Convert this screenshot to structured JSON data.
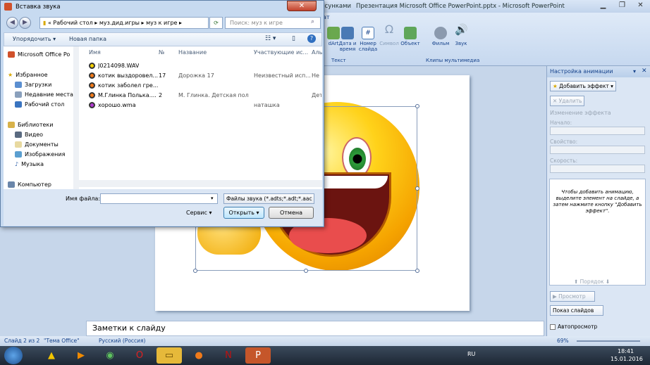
{
  "powerpoint": {
    "title": "Презентация Microsoft Office PowerPoint.pptx - Microsoft PowerPoint",
    "ribbon_tab_partial": "исунками",
    "ribbon_tab_partial2": "ат",
    "ribbon_buttons": [
      {
        "label": "dArt",
        "icon": "smartart-icon"
      },
      {
        "label": "Дата и время",
        "icon": "calendar-icon"
      },
      {
        "label": "Номер слайда",
        "icon": "slide-number-icon"
      },
      {
        "label": "Символ",
        "icon": "omega-icon"
      },
      {
        "label": "Объект",
        "icon": "object-icon"
      },
      {
        "label": "Фильм",
        "icon": "film-icon"
      },
      {
        "label": "Звук",
        "icon": "sound-icon"
      }
    ],
    "group_text": "Текст",
    "group_media": "Клипы мультимедиа",
    "notes_placeholder": "Заметки к слайду",
    "status": {
      "slide": "Слайд 2 из 2",
      "theme": "\"Тема Office\"",
      "language": "Русский (Россия)",
      "zoom": "69%"
    }
  },
  "anim_pane": {
    "title": "Настройка анимации",
    "add_effect": "Добавить эффект",
    "remove": "Удалить",
    "change_effect": "Изменение эффекта",
    "start_label": "Начало:",
    "property_label": "Свойство:",
    "speed_label": "Скорость:",
    "hint": "Чтобы добавить анимацию, выделите элемент на слайде, а затем нажмите кнопку \"Добавить эффект\".",
    "order_label": "Порядок",
    "preview": "Просмотр",
    "slideshow": "Показ слайдов",
    "autopreview": "Автопросмотр"
  },
  "dialog": {
    "title": "Вставка звука",
    "breadcrumb": [
      "«",
      "Рабочий стол",
      "муз.дид.игры",
      "муз к игре"
    ],
    "search_placeholder": "Поиск: муз к игре",
    "toolbar": {
      "organize": "Упорядочить",
      "new_folder": "Новая папка"
    },
    "nav": {
      "office": "Microsoft Office Po",
      "favorites": "Избранное",
      "downloads": "Загрузки",
      "recent": "Недавние места",
      "desktop": "Рабочий стол",
      "libraries": "Библиотеки",
      "video": "Видео",
      "documents": "Документы",
      "images": "Изображения",
      "music": "Музыка",
      "computer": "Компьютер"
    },
    "columns": {
      "name": "Имя",
      "num": "№",
      "title": "Название",
      "artists": "Участвующие ис...",
      "album": "Аль"
    },
    "files": [
      {
        "name": "J0214098.WAV",
        "num": "",
        "title": "",
        "artist": "",
        "album": "",
        "color": "#f5d000"
      },
      {
        "name": "котик выздоровел...",
        "num": "17",
        "title": "Дорожка 17",
        "artist": "Неизвестный исп...",
        "album": "Не",
        "color": "#f07a1a"
      },
      {
        "name": "котик заболел гре...",
        "num": "",
        "title": "",
        "artist": "",
        "album": "",
        "color": "#f07a1a"
      },
      {
        "name": "М.Глинка Полька....",
        "num": "2",
        "title": "М. Глинка. Детская поль...",
        "artist": "",
        "album": "Дет",
        "color": "#f07a1a"
      },
      {
        "name": "хорошо.wma",
        "num": "",
        "title": "",
        "artist": "наташка",
        "album": "",
        "color": "#b03ad0"
      }
    ],
    "filename_label": "Имя файла:",
    "filename_value": "",
    "filetype": "Файлы звука (*.adts;*.adt;*.aac",
    "service": "Сервис",
    "open": "Открыть",
    "cancel": "Отмена"
  },
  "taskbar": {
    "lang": "RU",
    "time": "18:41",
    "date": "15.01.2016"
  }
}
